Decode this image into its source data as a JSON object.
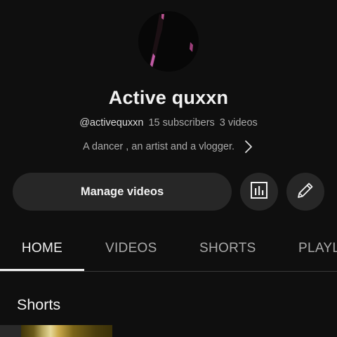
{
  "channel": {
    "name": "Active quxxn",
    "handle": "@activequxxn",
    "subscribers": "15 subscribers",
    "videos": "3 videos",
    "description": "A dancer , an artist and a vlogger."
  },
  "actions": {
    "manage_label": "Manage videos",
    "analytics_icon": "analytics-icon",
    "edit_icon": "pencil-icon"
  },
  "tabs": [
    {
      "label": "HOME",
      "active": true
    },
    {
      "label": "VIDEOS",
      "active": false
    },
    {
      "label": "SHORTS",
      "active": false
    },
    {
      "label": "PLAYLISTS",
      "active": false
    }
  ],
  "sections": {
    "shorts_title": "Shorts"
  },
  "colors": {
    "background": "#0f0f0f",
    "button_bg": "#272727",
    "text_primary": "#f1f1f1",
    "text_secondary": "#aaaaaa"
  }
}
